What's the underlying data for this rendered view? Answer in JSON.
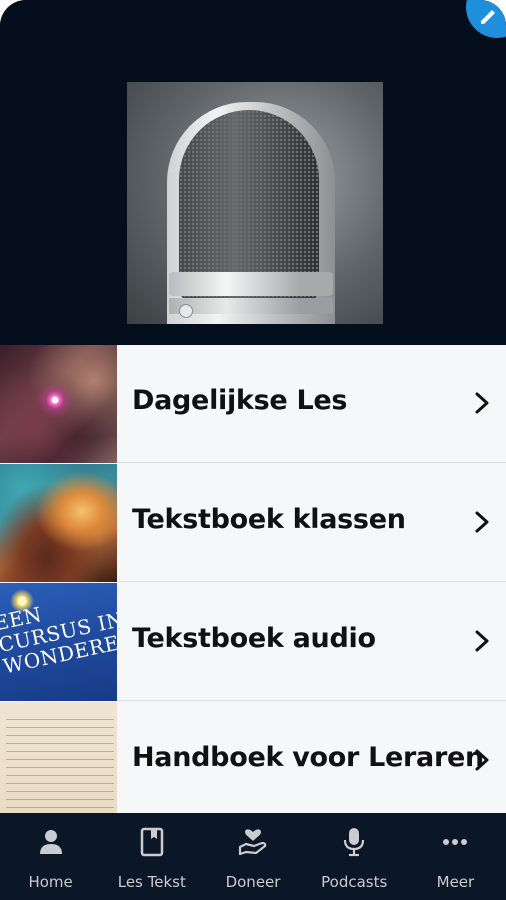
{
  "hero": {
    "image": "microphone-photo"
  },
  "list": {
    "items": [
      {
        "label": "Dagelijkse Les",
        "thumbnail": "space-star-image"
      },
      {
        "label": "Tekstboek klassen",
        "thumbnail": "nebula-image"
      },
      {
        "label": "Tekstboek audio",
        "thumbnail": "book-cover-image",
        "thumbnail_text": [
          "EEN",
          "CURSUS IN",
          "WONDEREN"
        ]
      },
      {
        "label": "Handboek voor Leraren",
        "thumbnail": "handbook-page-image"
      }
    ]
  },
  "nav": {
    "items": [
      {
        "label": "Home",
        "icon": "person-icon"
      },
      {
        "label": "Les Tekst",
        "icon": "book-icon"
      },
      {
        "label": "Doneer",
        "icon": "heart-hand-icon"
      },
      {
        "label": "Podcasts",
        "icon": "microphone-icon"
      },
      {
        "label": "Meer",
        "icon": "more-dots-icon"
      }
    ]
  },
  "colors": {
    "header_bg": "#050e1d",
    "nav_bg": "#0b1627",
    "list_bg": "#f6f7f9",
    "accent_badge": "#1f8fdc"
  }
}
